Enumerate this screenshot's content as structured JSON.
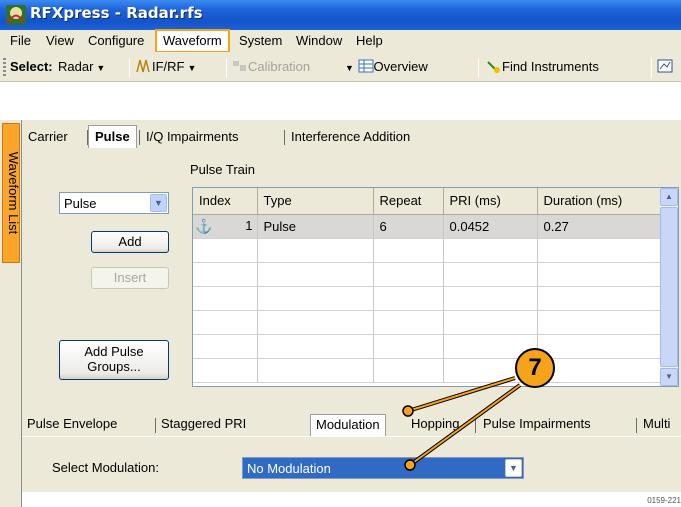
{
  "window": {
    "title": "RFXpress - Radar.rfs"
  },
  "menu": [
    "File",
    "View",
    "Configure",
    "Waveform",
    "System",
    "Window",
    "Help"
  ],
  "menu_active": "Waveform",
  "toolbar": {
    "select_label": "Select:",
    "select_value": "Radar",
    "ifrf_label": "IF/RF",
    "calibration_label": "Calibration",
    "overview_label": "Overview",
    "find_instruments_label": "Find Instruments"
  },
  "side_tab": {
    "label": "Waveform List"
  },
  "tabs": [
    "Carrier",
    "Pulse",
    "I/Q Impairments",
    "Interference Addition"
  ],
  "tabs_selected": "Pulse",
  "pulse_panel": {
    "type_select": "Pulse",
    "add_button": "Add",
    "insert_button": "Insert",
    "add_groups_line1": "Add Pulse",
    "add_groups_line2": "Groups...",
    "pulse_train_label": "Pulse Train",
    "columns": [
      "Index",
      "Type",
      "Repeat",
      "PRI (ms)",
      "Duration (ms)"
    ],
    "rows": [
      {
        "index": "1",
        "type": "Pulse",
        "repeat": "6",
        "pri": "0.0452",
        "duration": "0.27"
      }
    ]
  },
  "sub_tabs": [
    "Pulse Envelope",
    "Staggered PRI",
    "Modulation",
    "Hopping",
    "Pulse Impairments",
    "Multi"
  ],
  "sub_tabs_selected": "Modulation",
  "modulation": {
    "label": "Select Modulation:",
    "value": "No Modulation"
  },
  "callout": {
    "number": "7"
  },
  "figure_code": "0159-221"
}
